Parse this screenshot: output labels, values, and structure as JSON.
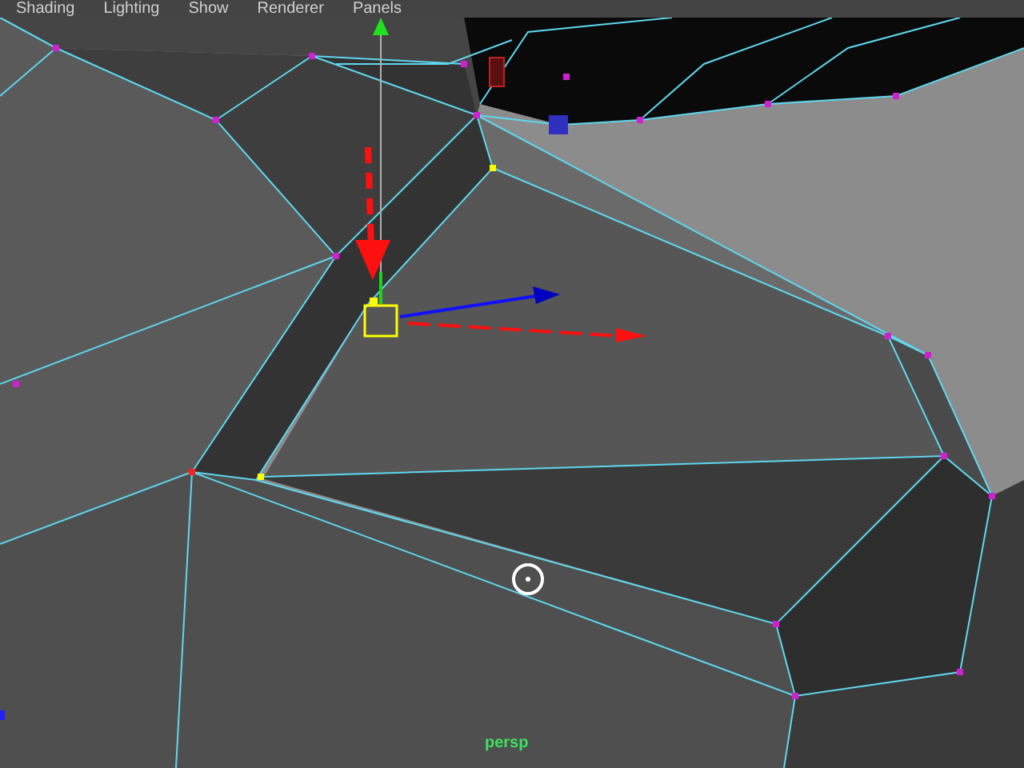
{
  "menu_bar": {
    "items": [
      "Shading",
      "Lighting",
      "Show",
      "Renderer",
      "Panels"
    ]
  },
  "viewport": {
    "camera_label": "persp"
  }
}
